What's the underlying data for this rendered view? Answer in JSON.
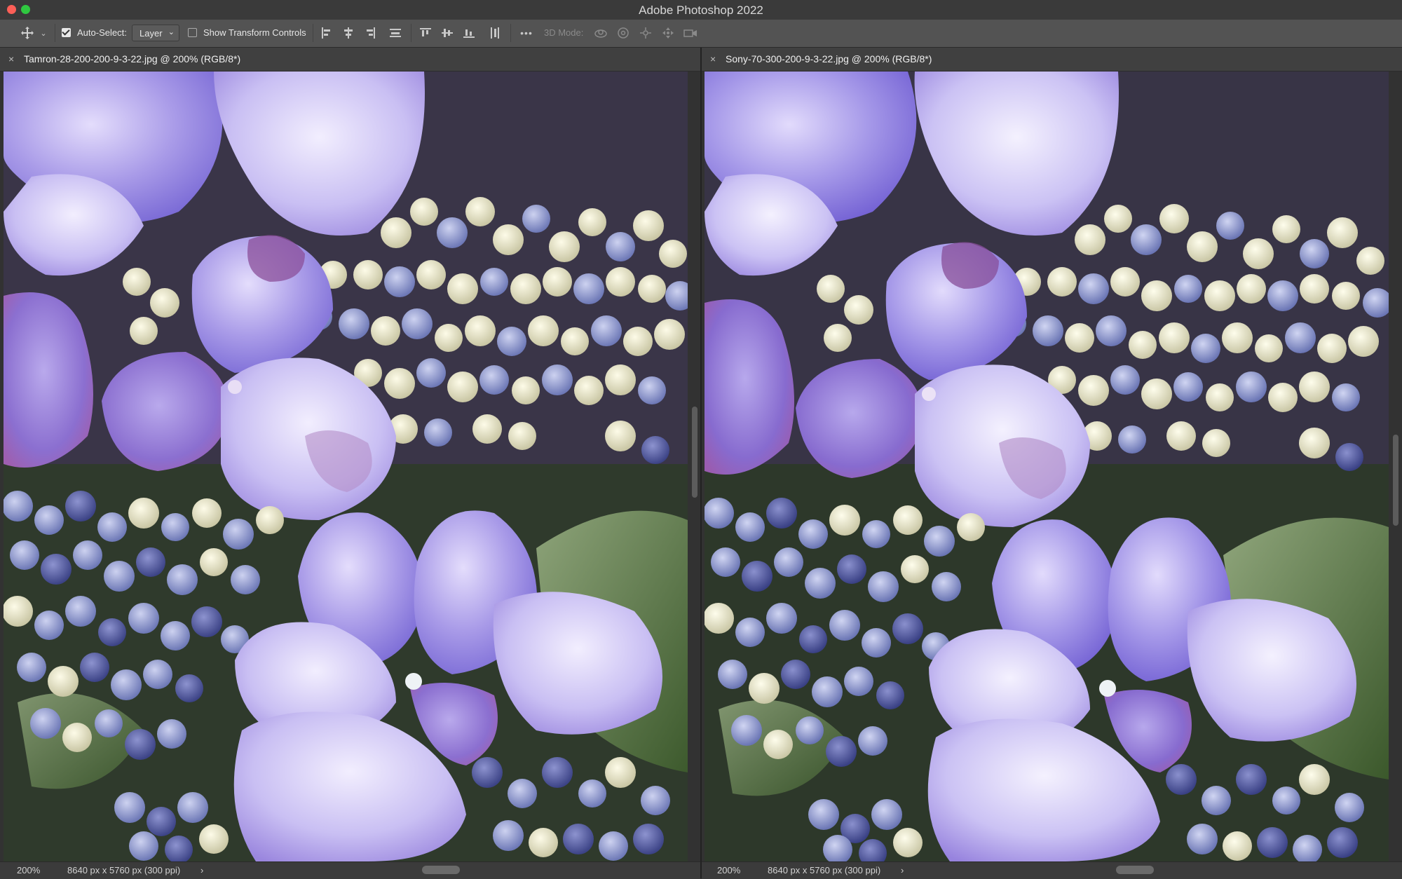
{
  "app": {
    "title": "Adobe Photoshop 2022",
    "window_controls": [
      "close-button",
      "minimize-button"
    ]
  },
  "options_bar": {
    "tool_icon": "move-tool-icon",
    "auto_select_label": "Auto-Select:",
    "auto_select_checked": true,
    "target_select_value": "Layer",
    "show_transform_label": "Show Transform Controls",
    "show_transform_checked": false,
    "align_icons": [
      "align-left-icon",
      "align-horizontal-center-icon",
      "align-right-icon",
      "distribute-vertical-icon",
      "align-top-icon",
      "align-vertical-center-icon",
      "align-bottom-icon",
      "distribute-horizontal-icon"
    ],
    "more_label": "•••",
    "mode_3d_label": "3D Mode:",
    "mode_3d_icons": [
      "orbit-3d-icon",
      "roll-3d-icon",
      "drag-3d-icon",
      "slide-3d-icon",
      "scale-3d-icon"
    ]
  },
  "documents": [
    {
      "tab_title": "Tamron-28-200-200-9-3-22.jpg @ 200% (RGB/8*)",
      "zoom": "200%",
      "doc_info": "8640 px x 5760 px (300 ppi)",
      "arrow": "›"
    },
    {
      "tab_title": "Sony-70-300-200-9-3-22.jpg @ 200% (RGB/8*)",
      "zoom": "200%",
      "doc_info": "8640 px x 5760 px (300 ppi)",
      "arrow": "›"
    }
  ],
  "close_glyph": "×",
  "colors": {
    "petal": "#9a8ee6",
    "petal_light": "#dcd6fb",
    "petal_deep": "#6c5bd0",
    "petal_pink": "#b07ac8",
    "bud_cream": "#e9e6c8",
    "bud_blue": "#8791c8",
    "bud_dark": "#4f589e",
    "leaf": "#4e6b3c",
    "shadow": "#2a2838"
  }
}
